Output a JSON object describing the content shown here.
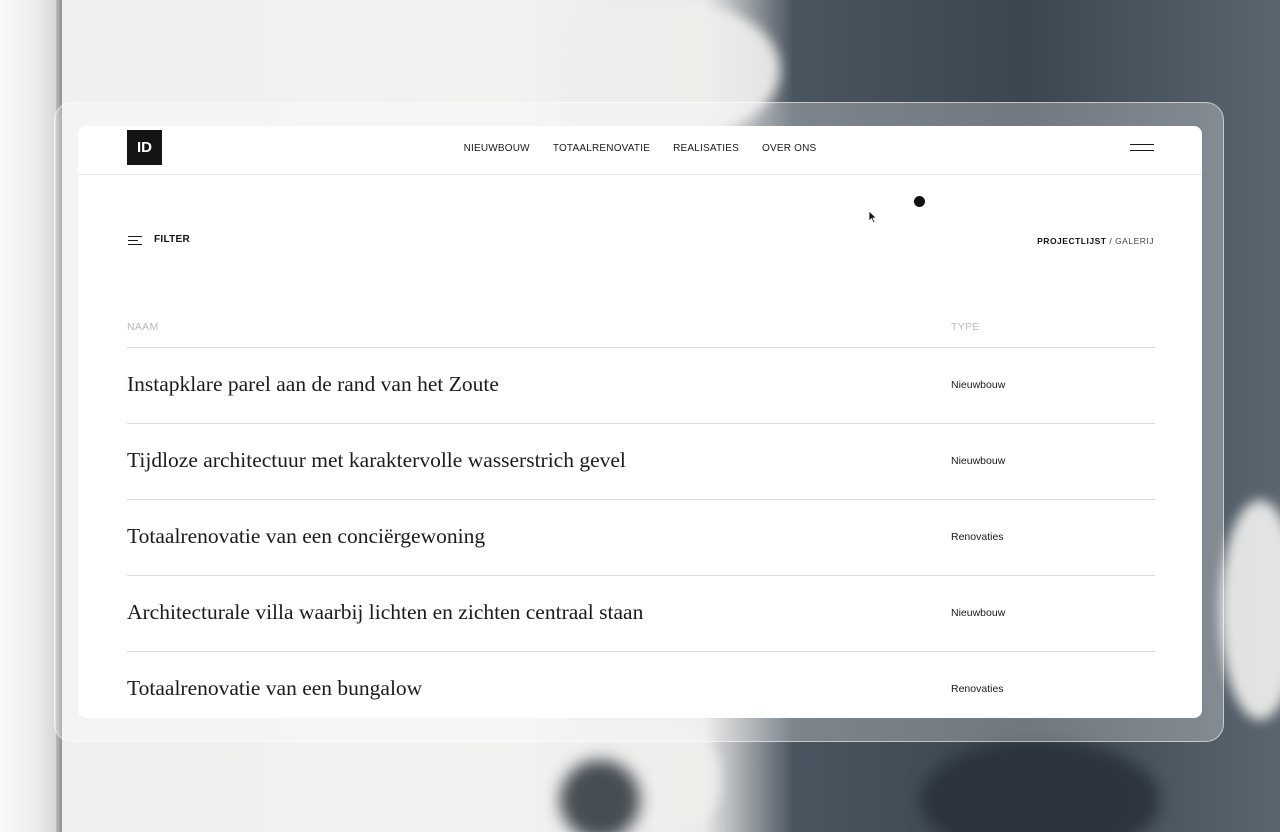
{
  "nav": {
    "logo_text": "ID",
    "links": [
      "NIEUWBOUW",
      "TOTAALRENOVATIE",
      "REALISATIES",
      "OVER ONS"
    ],
    "menu_icon": "hamburger-menu-icon"
  },
  "toolbar": {
    "filter_label": "FILTER",
    "filter_icon": "filter-lines-icon",
    "view_active": "PROJECTLIJST",
    "view_separator": "/",
    "view_inactive": "GALERIJ"
  },
  "table": {
    "headers": {
      "name": "NAAM",
      "type": "TYPE"
    },
    "rows": [
      {
        "name": "Instapklare parel aan de rand van het Zoute",
        "type": "Nieuwbouw"
      },
      {
        "name": "Tijdloze architectuur met karaktervolle wasserstrich gevel",
        "type": "Nieuwbouw"
      },
      {
        "name": "Totaalrenovatie van een conciërgewoning",
        "type": "Renovaties"
      },
      {
        "name": "Architecturale villa waarbij lichten en zichten centraal staan",
        "type": "Nieuwbouw"
      },
      {
        "name": "Totaalrenovatie van een bungalow",
        "type": "Renovaties"
      }
    ]
  },
  "colors": {
    "text": "#1b1b1b",
    "logo_bg": "#141414",
    "divider": "#d9d9d9",
    "header_muted": "#bbbbbb"
  }
}
